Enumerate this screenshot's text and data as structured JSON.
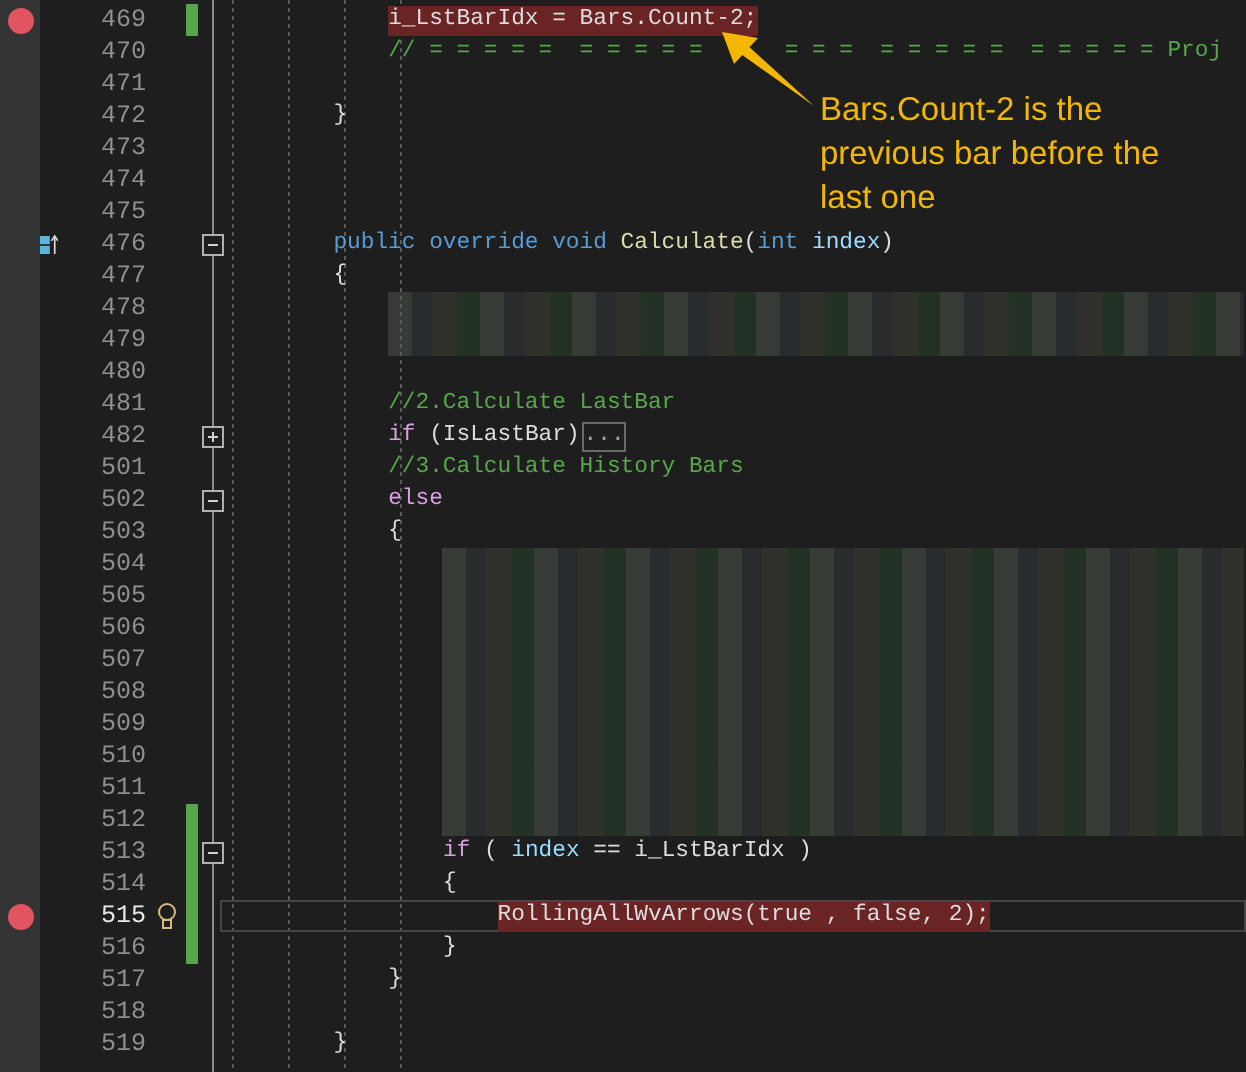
{
  "editor": {
    "lines": [
      {
        "number": "469",
        "breakpoint": true,
        "changed": true,
        "highlighted": true,
        "tokens": [
          {
            "kind": "plain",
            "text": "i_LstBarIdx = Bars.Count-2;"
          }
        ]
      },
      {
        "number": "470",
        "tokens": [
          {
            "kind": "comment",
            "text": "// = = = = =  = = = = ="
          },
          {
            "kind": "comment",
            "text": "= = =  = = = = =  = = = = = Proj"
          }
        ]
      },
      {
        "number": "471"
      },
      {
        "number": "472",
        "tokens": [
          {
            "kind": "plain",
            "text": "}"
          }
        ]
      },
      {
        "number": "473"
      },
      {
        "number": "474"
      },
      {
        "number": "475"
      },
      {
        "number": "476",
        "foldable": true,
        "expanded": true,
        "codelens": true,
        "tokens": [
          {
            "kind": "keyword",
            "text": "public override void "
          },
          {
            "kind": "method",
            "text": "Calculate"
          },
          {
            "kind": "plain",
            "text": "("
          },
          {
            "kind": "keyword",
            "text": "int "
          },
          {
            "kind": "param",
            "text": "index"
          },
          {
            "kind": "plain",
            "text": ")"
          }
        ]
      },
      {
        "number": "477",
        "tokens": [
          {
            "kind": "plain",
            "text": "{"
          }
        ]
      },
      {
        "number": "478",
        "redacted": true
      },
      {
        "number": "479",
        "redacted": true
      },
      {
        "number": "480"
      },
      {
        "number": "481",
        "tokens": [
          {
            "kind": "comment",
            "text": "//2.Calculate LastBar"
          }
        ]
      },
      {
        "number": "482",
        "foldable": true,
        "expanded": false,
        "tokens": [
          {
            "kind": "control",
            "text": "if "
          },
          {
            "kind": "plain",
            "text": "(IsLastBar)"
          },
          {
            "kind": "collapsed",
            "text": "..."
          }
        ]
      },
      {
        "number": "501",
        "tokens": [
          {
            "kind": "comment",
            "text": "//3.Calculate History Bars"
          }
        ]
      },
      {
        "number": "502",
        "foldable": true,
        "expanded": true,
        "tokens": [
          {
            "kind": "control",
            "text": "else"
          }
        ]
      },
      {
        "number": "503",
        "tokens": [
          {
            "kind": "plain",
            "text": "{"
          }
        ]
      },
      {
        "number": "504",
        "redacted": true
      },
      {
        "number": "505",
        "redacted": true
      },
      {
        "number": "506",
        "redacted": true
      },
      {
        "number": "507",
        "redacted": true
      },
      {
        "number": "508",
        "redacted": true
      },
      {
        "number": "509",
        "redacted": true
      },
      {
        "number": "510",
        "redacted": true
      },
      {
        "number": "511",
        "redacted": true
      },
      {
        "number": "512",
        "redacted": true,
        "changed": true
      },
      {
        "number": "513",
        "changed": true,
        "foldable": true,
        "expanded": true,
        "tokens": [
          {
            "kind": "control",
            "text": "if "
          },
          {
            "kind": "plain",
            "text": "( "
          },
          {
            "kind": "param",
            "text": "index"
          },
          {
            "kind": "plain",
            "text": " == i_LstBarIdx )"
          }
        ]
      },
      {
        "number": "514",
        "changed": true,
        "tokens": [
          {
            "kind": "plain",
            "text": "{"
          }
        ]
      },
      {
        "number": "515",
        "breakpoint": true,
        "changed": true,
        "highlighted": true,
        "current": true,
        "lightbulb": true,
        "tokens": [
          {
            "kind": "plain",
            "text": "RollingAllWvArrows(true , false, 2);"
          }
        ]
      },
      {
        "number": "516",
        "changed": true,
        "tokens": [
          {
            "kind": "plain",
            "text": "}"
          }
        ]
      },
      {
        "number": "517",
        "tokens": [
          {
            "kind": "plain",
            "text": "}"
          }
        ]
      },
      {
        "number": "518"
      },
      {
        "number": "519",
        "tokens": [
          {
            "kind": "plain",
            "text": "}"
          }
        ]
      }
    ]
  },
  "callout": {
    "text": "Bars.Count-2 is the previous bar before the last one"
  }
}
